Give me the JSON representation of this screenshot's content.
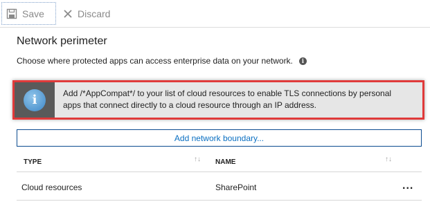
{
  "toolbar": {
    "save_label": "Save",
    "discard_label": "Discard"
  },
  "section": {
    "title": "Network perimeter",
    "description": "Choose where protected apps can access enterprise data on your network."
  },
  "banner": {
    "icon_glyph": "i",
    "text": "Add /*AppCompat*/ to your list of cloud resources to enable TLS connections by personal apps that connect directly to a cloud resource through an IP address."
  },
  "add_button": {
    "label": "Add network boundary..."
  },
  "table": {
    "columns": [
      {
        "label": "TYPE",
        "sort_glyph": "↑↓"
      },
      {
        "label": "NAME",
        "sort_glyph": "↑↓"
      }
    ],
    "rows": [
      {
        "type": "Cloud resources",
        "name": "SharePoint",
        "more": "..."
      }
    ]
  },
  "colors": {
    "accent": "#0a6fc2",
    "highlight_border": "#e03a3a",
    "banner_bg": "#e6e6e6",
    "banner_icon_bg": "#5a5a5a"
  },
  "icons": {
    "save": "floppy-disk-icon",
    "discard": "close-icon",
    "info": "info-icon"
  }
}
